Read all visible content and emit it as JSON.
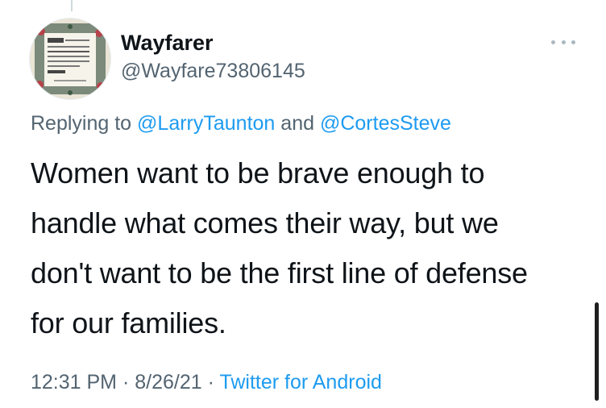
{
  "tweet": {
    "author": {
      "display_name": "Wayfarer",
      "handle": "@Wayfare73806145",
      "avatar_icon": "framed-quote-avatar"
    },
    "more_icon": "more-horizontal-icon",
    "replying_prefix": "Replying to",
    "replying_conjunction": "and",
    "replying_to": [
      "@LarryTaunton",
      "@CortesSteve"
    ],
    "text_lines": [
      "Women want to be brave enough to",
      "handle what comes their way, but we",
      "don't want to be the first line of defense",
      "for our families."
    ],
    "time": "12:31 PM",
    "separator": "·",
    "date": "8/26/21",
    "source": "Twitter for Android"
  },
  "colors": {
    "link": "#1d9bf0",
    "secondary_text": "#536471",
    "primary_text": "#0f1419"
  }
}
